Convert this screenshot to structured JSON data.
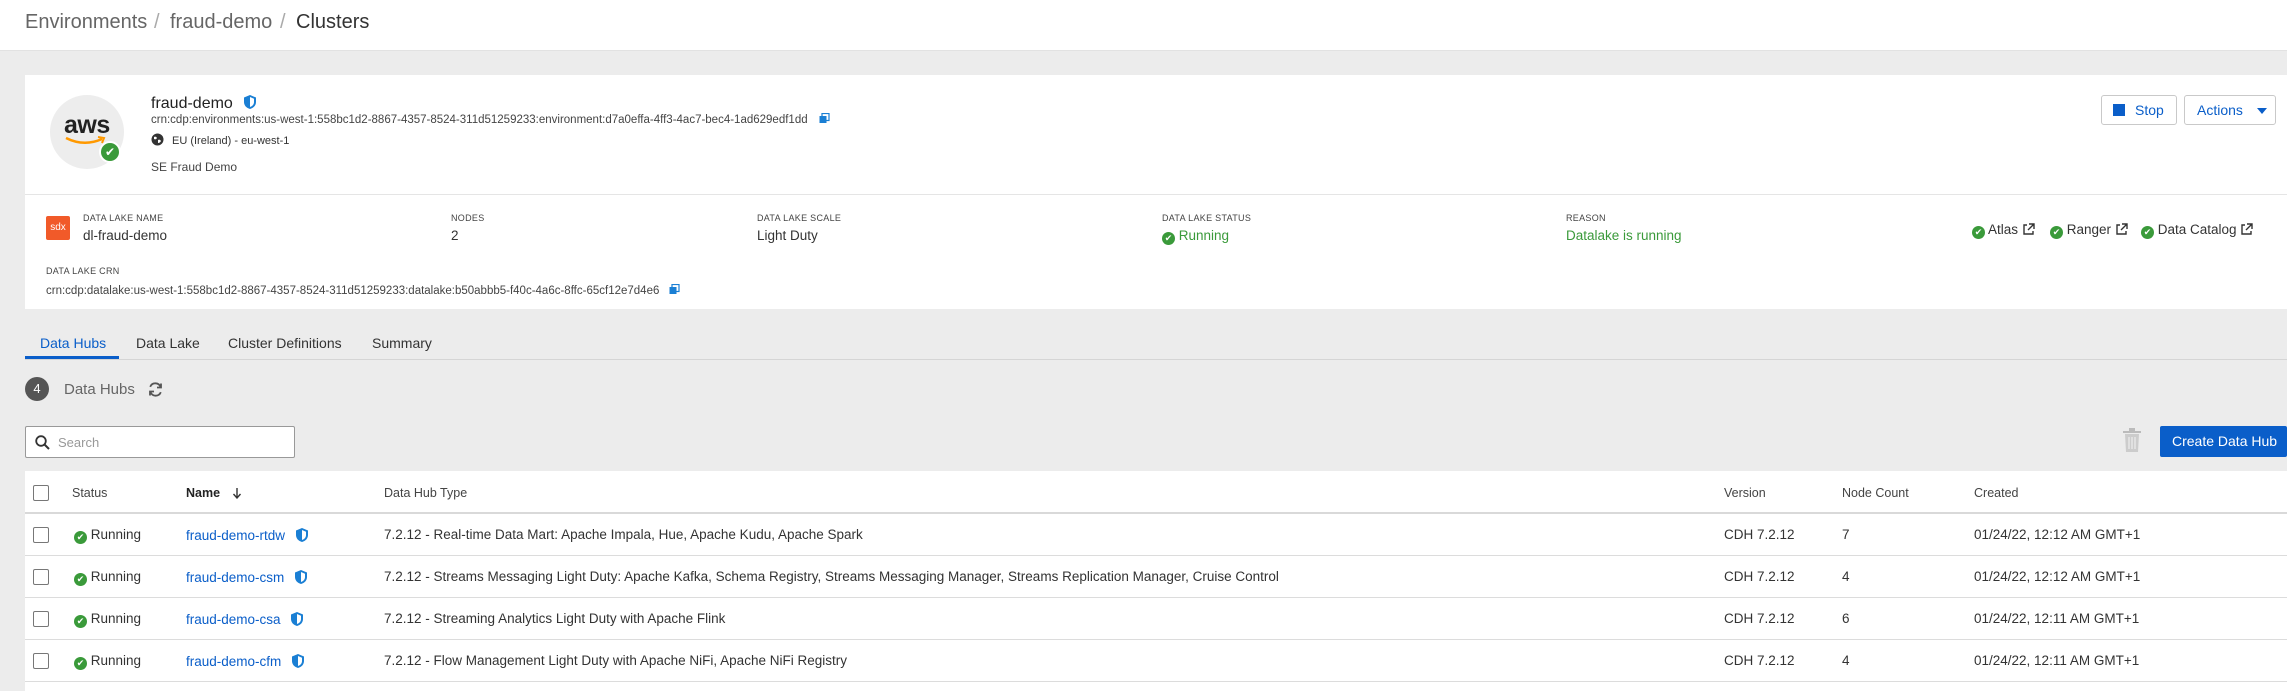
{
  "breadcrumb": [
    "Environments",
    "fraud-demo",
    "Clusters"
  ],
  "environment": {
    "name": "fraud-demo",
    "crn": "crn:cdp:environments:us-west-1:558bc1d2-8867-4357-8524-311d51259233:environment:d7a0effa-4ff3-4ac7-bec4-1ad629edf1dd",
    "region": "EU (Ireland) - eu-west-1",
    "description": "SE Fraud Demo",
    "logo_text": "aws",
    "stop_label": "Stop",
    "actions_label": "Actions"
  },
  "datalake": {
    "badge": "sdx",
    "name_label": "DATA LAKE NAME",
    "name": "dl-fraud-demo",
    "nodes_label": "NODES",
    "nodes": "2",
    "scale_label": "DATA LAKE SCALE",
    "scale": "Light Duty",
    "status_label": "DATA LAKE STATUS",
    "status": "Running",
    "reason_label": "REASON",
    "reason": "Datalake is running",
    "services": [
      "Atlas",
      "Ranger",
      "Data Catalog"
    ],
    "crn_label": "DATA LAKE CRN",
    "crn": "crn:cdp:datalake:us-west-1:558bc1d2-8867-4357-8524-311d51259233:datalake:b50abbb5-f40c-4a6c-8ffc-65cf12e7d4e6"
  },
  "tabs": [
    "Data Hubs",
    "Data Lake",
    "Cluster Definitions",
    "Summary"
  ],
  "hubs": {
    "count": "4",
    "title": "Data Hubs",
    "search_placeholder": "Search",
    "create_label": "Create Data Hub"
  },
  "table": {
    "headers": {
      "status": "Status",
      "name": "Name",
      "type": "Data Hub Type",
      "version": "Version",
      "node_count": "Node Count",
      "created": "Created"
    },
    "rows": [
      {
        "status": "Running",
        "name": "fraud-demo-rtdw",
        "type": "7.2.12 - Real-time Data Mart: Apache Impala, Hue, Apache Kudu, Apache Spark",
        "version": "CDH 7.2.12",
        "nodes": "7",
        "created": "01/24/22, 12:12 AM GMT+1"
      },
      {
        "status": "Running",
        "name": "fraud-demo-csm",
        "type": "7.2.12 - Streams Messaging Light Duty: Apache Kafka, Schema Registry, Streams Messaging Manager, Streams Replication Manager, Cruise Control",
        "version": "CDH 7.2.12",
        "nodes": "4",
        "created": "01/24/22, 12:12 AM GMT+1"
      },
      {
        "status": "Running",
        "name": "fraud-demo-csa",
        "type": "7.2.12 - Streaming Analytics Light Duty with Apache Flink",
        "version": "CDH 7.2.12",
        "nodes": "6",
        "created": "01/24/22, 12:11 AM GMT+1"
      },
      {
        "status": "Running",
        "name": "fraud-demo-cfm",
        "type": "7.2.12 - Flow Management Light Duty with Apache NiFi, Apache NiFi Registry",
        "version": "CDH 7.2.12",
        "nodes": "4",
        "created": "01/24/22, 12:11 AM GMT+1"
      }
    ]
  },
  "colors": {
    "link": "#0a5ec9",
    "success": "#3a9a3a",
    "sdx": "#f15a29",
    "primary_button": "#0a5ec9"
  }
}
